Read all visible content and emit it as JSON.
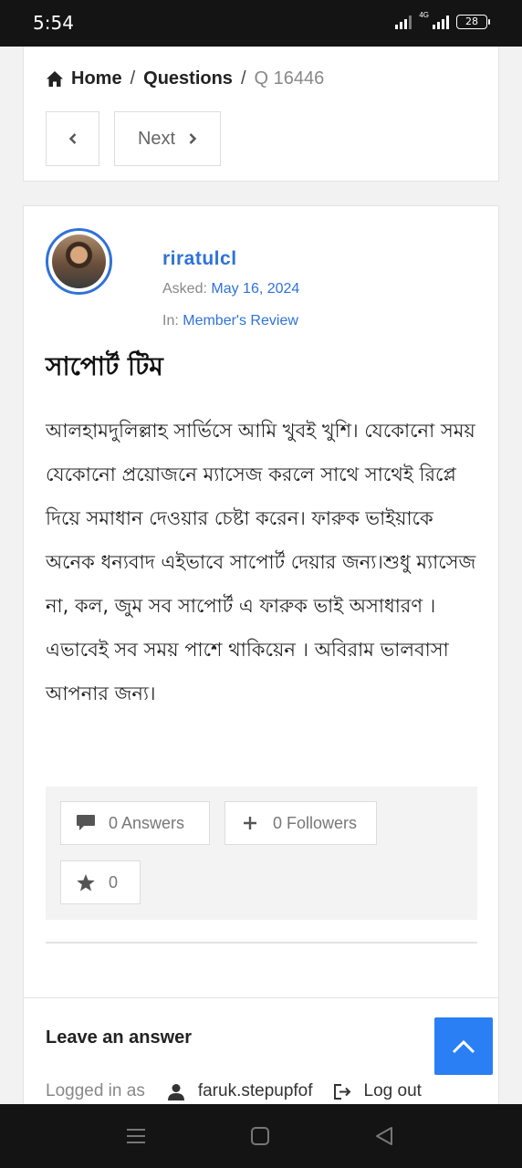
{
  "status_bar": {
    "time": "5:54",
    "network": "4G",
    "battery": "28"
  },
  "breadcrumb": {
    "home": "Home",
    "sep1": "/",
    "questions": "Questions",
    "sep2": "/",
    "current": "Q 16446"
  },
  "pager": {
    "next_label": "Next"
  },
  "question": {
    "author": "riratulcl",
    "asked_label": "Asked:",
    "asked_date": "May 16, 2024",
    "in_label": "In:",
    "category": "Member's Review",
    "title": "সাপোর্ট টিম",
    "body": "আলহামদুলিল্লাহ সার্ভিসে আমি খুবই খুশি। যেকোনো সময় যেকোনো প্রয়োজনে ম্যাসেজ করলে সাথে সাথেই রিপ্লে দিয়ে সমাধান দেওয়ার চেষ্টা করেন। ফারুক ভাইয়াকে অনেক ধন্যবাদ এইভাবে সাপোর্ট দেয়ার জন্য।শুধু  ম্যাসেজ না, কল, জুম সব  সাপোর্ট এ  ফারুক ভাই অসাধারণ ।  এভাবেই সব সময় পাশে থাকিয়েন । অবিরাম ভালবাসা আপনার জন্য।"
  },
  "actions": {
    "answers": "0 Answers",
    "followers": "0 Followers",
    "favorites": "0"
  },
  "answer_section": {
    "title": "Leave an answer",
    "logged_in_as": "Logged in as",
    "username": "faruk.stepupfof",
    "logout": "Log out"
  },
  "colors": {
    "accent": "#2f72d8",
    "scroll_button": "#2a7ff5"
  }
}
